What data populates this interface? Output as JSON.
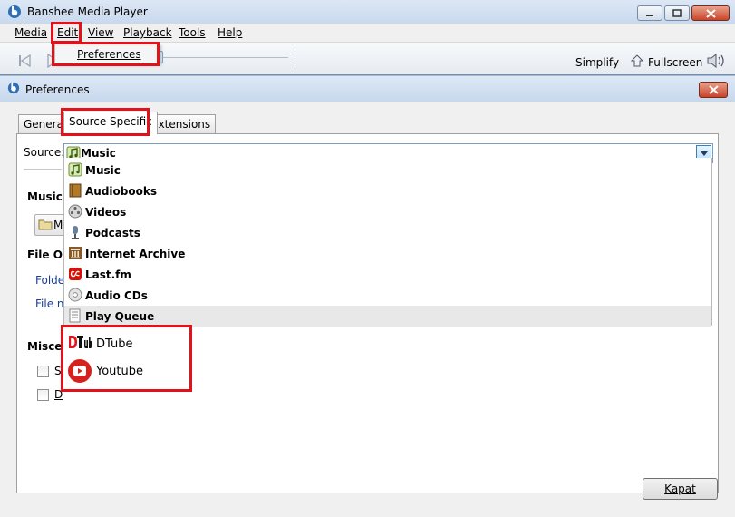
{
  "app": {
    "title": "Banshee Media Player",
    "menu": [
      "Media",
      "Edit",
      "View",
      "Playback",
      "Tools",
      "Help"
    ],
    "edit_menu_item": "Preferences",
    "toolbar": {
      "simplify": "Simplify",
      "fullscreen": "Fullscreen"
    }
  },
  "dialog": {
    "title": "Preferences",
    "tabs": [
      "General",
      "Source Specific",
      "Extensions"
    ],
    "active_tab": "Source Specific",
    "source": {
      "label": "Source:",
      "selected": "Music"
    },
    "sections": {
      "music_folder_partial": "Music F",
      "folder_button_partial": "M",
      "file_org_partial": "File Org",
      "folder_partial": "Folder",
      "file_name_partial": "File na",
      "misc_partial": "Miscell",
      "check1_partial": "S",
      "check2_partial": "D"
    },
    "close_button": "Kapat"
  },
  "source_list": [
    {
      "label": "Music",
      "icon": "music-icon"
    },
    {
      "label": "Audiobooks",
      "icon": "audiobook-icon"
    },
    {
      "label": "Videos",
      "icon": "video-icon"
    },
    {
      "label": "Podcasts",
      "icon": "podcast-icon"
    },
    {
      "label": "Internet Archive",
      "icon": "internet-archive-icon"
    },
    {
      "label": "Last.fm",
      "icon": "lastfm-icon"
    },
    {
      "label": "Audio CDs",
      "icon": "cd-icon"
    },
    {
      "label": "Play Queue",
      "icon": "play-queue-icon"
    }
  ],
  "added_sources": [
    {
      "label": "DTube",
      "icon": "dtube-logo"
    },
    {
      "label": "Youtube",
      "icon": "youtube-logo"
    }
  ],
  "colors": {
    "highlight": "#e2121b",
    "combo_arrow": "#3c7fb1",
    "youtube": "#d6211d"
  }
}
